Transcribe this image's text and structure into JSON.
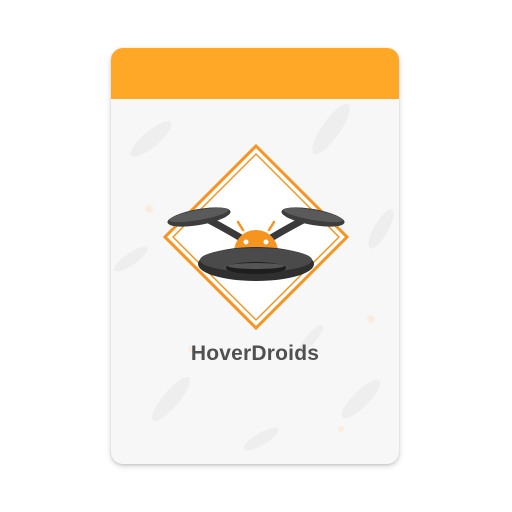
{
  "app": {
    "name": "HoverDroids"
  },
  "card": {
    "header_color": "#ffa726",
    "background_color": "#f7f7f7"
  },
  "logo": {
    "icon": "drone-android-logo-icon",
    "frame_color": "#f7931e",
    "android_color": "#f5941f"
  }
}
